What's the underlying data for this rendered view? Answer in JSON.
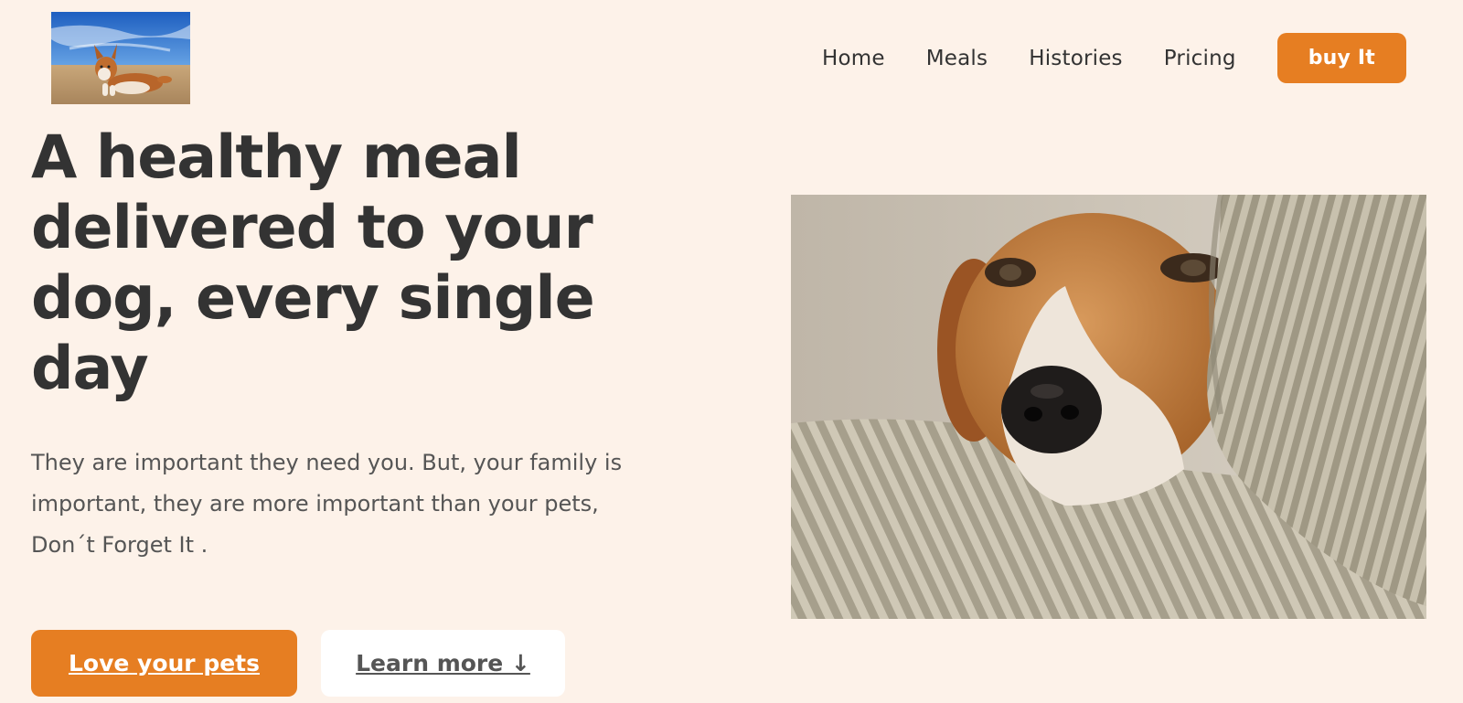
{
  "header": {
    "logo_icon": "corgi-photo",
    "nav": {
      "items": [
        "Home",
        "Meals",
        "Histories",
        "Pricing"
      ],
      "cta_label": "buy It"
    }
  },
  "hero": {
    "title": "A healthy meal delivered to your dog, every single day",
    "description_lines": [
      "They are important they need you. But, your family is",
      "important, they are more important than your pets,",
      "Don´t Forget It ."
    ],
    "primary_button": "Love your pets",
    "secondary_button": "Learn more ↓",
    "image_icon": "beagle-photo"
  },
  "colors": {
    "background": "#fdf2e9",
    "accent": "#e67e22",
    "text": "#333333"
  }
}
